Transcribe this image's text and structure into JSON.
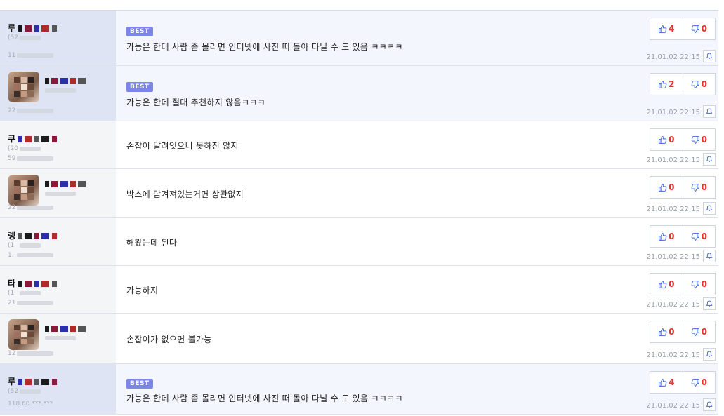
{
  "comments": [
    {
      "best": true,
      "badge": "BEST",
      "nick": "루",
      "info1": "(52",
      "info2": "11",
      "has_avatar": false,
      "content": "가능은 한데 사람 좀 몰리면 인터넷에 사진 떠 돌아 다닐 수 도 있음 ㅋㅋㅋㅋ",
      "up": "4",
      "down": "0",
      "date": "21.01.02 22:15"
    },
    {
      "best": true,
      "badge": "BEST",
      "nick": "",
      "info1": "",
      "info2": "22",
      "has_avatar": true,
      "content": "가능은 한데 절대 추천하지 않음ㅋㅋㅋ",
      "up": "2",
      "down": "0",
      "date": "21.01.02 22:15"
    },
    {
      "best": false,
      "nick": "쿠",
      "info1": "(20",
      "info2": "59",
      "has_avatar": false,
      "content": "손잡이 달려잇으니 못하진 않지",
      "up": "0",
      "down": "0",
      "date": "21.01.02 22:15"
    },
    {
      "best": false,
      "nick": "",
      "info1": "",
      "info2": "22",
      "has_avatar": true,
      "content": "박스에 담겨져있는거면 상관없지",
      "up": "0",
      "down": "0",
      "date": "21.01.02 22:15"
    },
    {
      "best": false,
      "nick": "렝",
      "info1": "(1",
      "info2": "1.",
      "has_avatar": false,
      "content": "해봤는데 된다",
      "up": "0",
      "down": "0",
      "date": "21.01.02 22:15"
    },
    {
      "best": false,
      "nick": "타",
      "info1": "(1",
      "info2": "21",
      "has_avatar": false,
      "content": "가능하지",
      "up": "0",
      "down": "0",
      "date": "21.01.02 22:15"
    },
    {
      "best": false,
      "nick": "",
      "info1": "",
      "info2": "12",
      "has_avatar": true,
      "content": "손잡이가 없으면 불가능",
      "up": "0",
      "down": "0",
      "date": "21.01.02 22:15"
    },
    {
      "best": true,
      "badge": "BEST",
      "nick": "루",
      "info1": "(52",
      "info2": "118.60.***.***",
      "has_avatar": false,
      "content": "가능은 한데 사람 좀 몰리면 인터넷에 사진 떠 돌아 다닐 수 도 있음 ㅋㅋㅋㅋ",
      "up": "4",
      "down": "0",
      "date": "21.01.02 22:15"
    }
  ],
  "colors": {
    "vote_count": "#e53030",
    "thumb_icon": "#3f66d8",
    "badge_bg": "#7b86e6"
  },
  "icons": {
    "up": "thumbs-up-icon",
    "down": "thumbs-down-icon",
    "report": "bell-icon"
  }
}
